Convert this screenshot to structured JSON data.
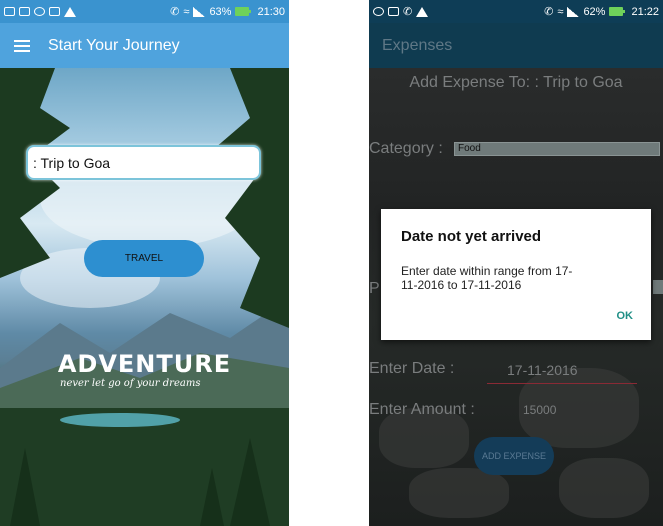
{
  "screens": [
    {
      "status_bar": {
        "battery": "63%",
        "time": "21:30"
      },
      "app_bar": {
        "title": "Start Your Journey"
      },
      "trip_input": {
        "value": ": Trip to Goa"
      },
      "travel_button": {
        "label": "TRAVEL"
      },
      "poster": {
        "title": "ADVENTURE",
        "subtitle": "never let go of your dreams"
      }
    },
    {
      "status_bar": {
        "battery": "62%",
        "time": "21:22"
      },
      "app_bar": {
        "title": "Expenses"
      },
      "form": {
        "heading": "Add Expense To: : Trip to Goa",
        "category_label": "Category :",
        "category_value": "Food",
        "payment_label": "P",
        "date_label": "Enter Date :",
        "date_value": "17-11-2016",
        "amount_label": "Enter Amount :",
        "amount_value": "15000",
        "add_button": "ADD EXPENSE"
      },
      "dialog": {
        "title": "Date not yet arrived",
        "message": "Enter date within range from 17-11-2016 to 17-11-2016",
        "ok": "OK"
      }
    }
  ],
  "icons": [
    "message-icon",
    "whatsapp-icon",
    "image-icon",
    "warning-icon",
    "call-icon",
    "wifi-icon",
    "signal-icon",
    "battery-icon",
    "menu-icon"
  ]
}
